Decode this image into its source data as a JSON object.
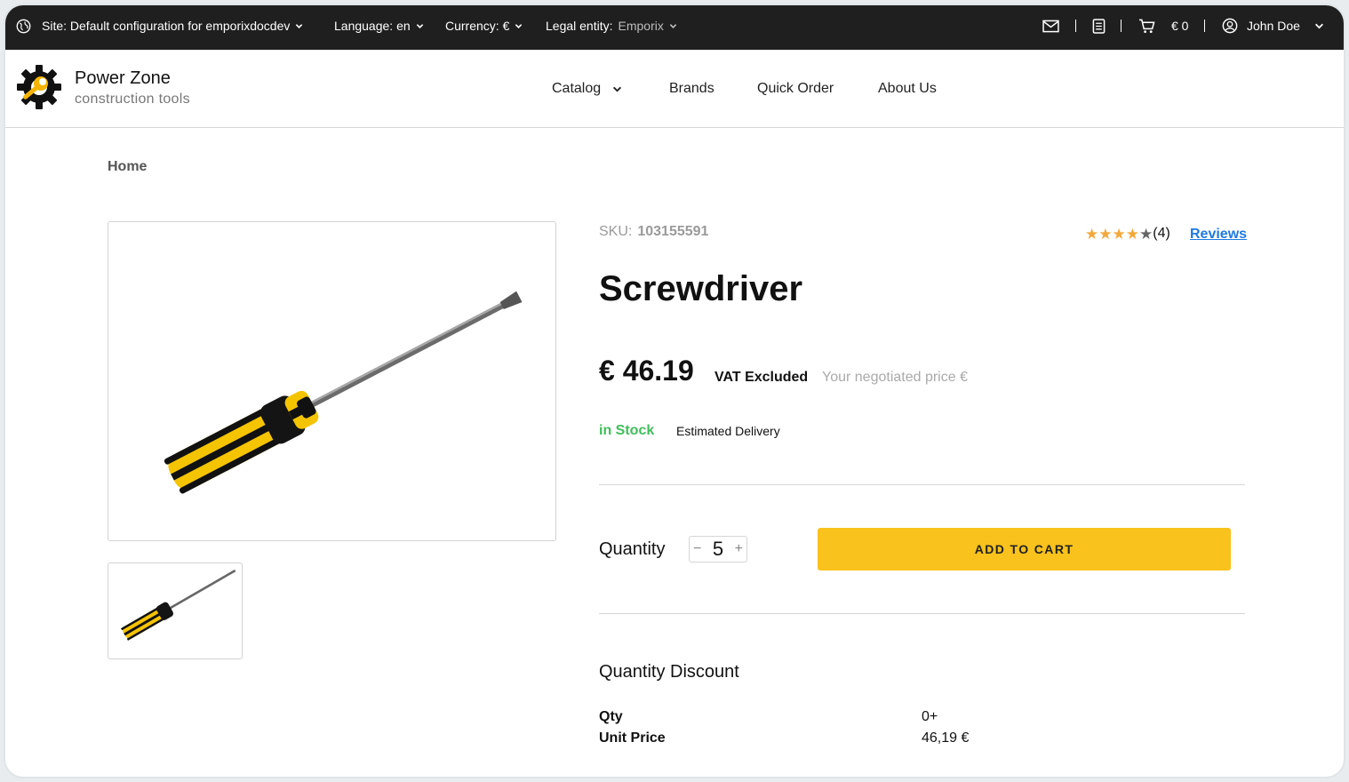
{
  "topbar": {
    "site_label": "Site: Default configuration for emporixdocdev",
    "language_label": "Language: en",
    "currency_label": "Currency: €",
    "legal_entity_prefix": "Legal entity:",
    "legal_entity_value": "Emporix",
    "cart_total": "€ 0",
    "user_name": "John Doe"
  },
  "header": {
    "brand_name": "Power Zone",
    "brand_sub": "construction tools",
    "nav": [
      "Catalog",
      "Brands",
      "Quick Order",
      "About Us"
    ]
  },
  "breadcrumb": "Home",
  "product": {
    "sku_label": "SKU:",
    "sku_value": "103155591",
    "rating_value": 4,
    "rating_max": 5,
    "review_count": "(4)",
    "reviews_link": "Reviews",
    "title": "Screwdriver",
    "price": "€ 46.19",
    "vat_label": "VAT Excluded",
    "negotiated_label": "Your negotiated price €",
    "stock_status": "in Stock",
    "delivery_label": "Estimated Delivery",
    "quantity_label": "Quantity",
    "quantity_value": "5",
    "minus_symbol": "−",
    "plus_symbol": "+",
    "add_to_cart": "ADD TO CART"
  },
  "discount": {
    "title": "Quantity Discount",
    "rows": [
      {
        "label": "Qty",
        "value": "0+"
      },
      {
        "label": "Unit Price",
        "value": "46,19 €"
      }
    ]
  },
  "colors": {
    "topbar_bg": "#1f1f1f",
    "accent_yellow": "#f9c21c",
    "stock_green": "#3fbe5a",
    "link_blue": "#1f7ae0",
    "star_filled": "#f2a93b"
  }
}
